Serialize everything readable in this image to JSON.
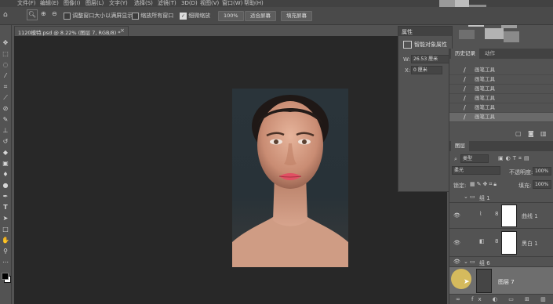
{
  "menu": [
    "文件(F)",
    "编辑(E)",
    "图像(I)",
    "图层(L)",
    "文字(Y)",
    "选择(S)",
    "滤镜(T)",
    "3D(D)",
    "视图(V)",
    "窗口(W)",
    "帮助(H)"
  ],
  "options": {
    "resize_windows": "调整窗口大小以满屏显示",
    "zoom_all": "缩放所有窗口",
    "scrubby_zoom": "细微缩放",
    "zoom_100": "100%",
    "fit_screen": "适合屏幕",
    "fill_screen": "填充屏幕"
  },
  "document_tab": "1120模特.psd @ 8.22% (图层 7, RGB/8) *",
  "properties": {
    "title": "属性",
    "item": "智能对象属性",
    "w_label": "W:",
    "w_value": "26.53 厘米",
    "x_label": "X:",
    "x_value": "0 厘米"
  },
  "history": {
    "tabs": [
      "历史记录",
      "动作"
    ],
    "items": [
      "画笔工具",
      "画笔工具",
      "画笔工具",
      "画笔工具",
      "画笔工具",
      "画笔工具"
    ]
  },
  "layers": {
    "tab": "图层",
    "kind": "类型",
    "blend_mode": "柔光",
    "opacity_label": "不透明度:",
    "opacity": "100%",
    "lock_label": "锁定:",
    "fill_label": "填充:",
    "fill": "100%",
    "items": [
      {
        "name": "组 1",
        "type": "group"
      },
      {
        "name": "曲线 1",
        "type": "adjustment"
      },
      {
        "name": "黑白 1",
        "type": "adjustment"
      },
      {
        "name": "组 6",
        "type": "group"
      },
      {
        "name": "图层 7",
        "type": "pixel"
      }
    ]
  },
  "icons": [
    "home-icon",
    "zoom-icon",
    "zoom-in-icon",
    "zoom-out-icon",
    "move-icon",
    "marquee-icon",
    "lasso-icon",
    "magic-wand-icon",
    "crop-icon",
    "eyedropper-icon",
    "healing-icon",
    "brush-icon",
    "stamp-icon",
    "history-brush-icon",
    "eraser-icon",
    "gradient-icon",
    "blur-icon",
    "dodge-icon",
    "pen-icon",
    "type-icon",
    "path-select-icon",
    "shape-icon",
    "hand-icon",
    "zoom-tool-icon",
    "eye-icon",
    "trash-icon",
    "camera-icon"
  ],
  "colors": {
    "accent": "#e8c85a",
    "canvas": "#282828",
    "panel": "#535353"
  }
}
